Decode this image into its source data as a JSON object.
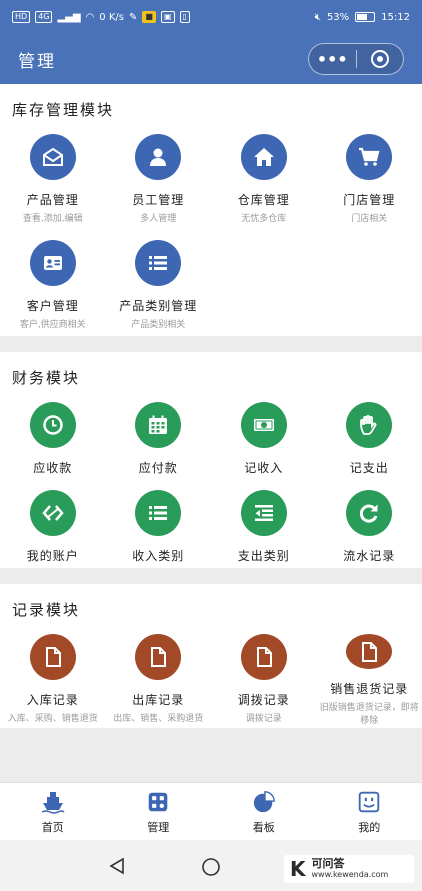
{
  "status_bar": {
    "left_chips": [
      "HD",
      "4G"
    ],
    "speed": "0 K/s",
    "battery_percent": "53%",
    "time": "15:12"
  },
  "nav": {
    "title": "管理",
    "more_label": "•••"
  },
  "sections": [
    {
      "title": "库存管理模块",
      "color": "#3d66b3",
      "items": [
        {
          "icon": "envelope-icon",
          "label": "产品管理",
          "desc": "查看,添加,编辑"
        },
        {
          "icon": "person-icon",
          "label": "员工管理",
          "desc": "多人管理"
        },
        {
          "icon": "home-icon",
          "label": "仓库管理",
          "desc": "无忧多仓库"
        },
        {
          "icon": "cart-icon",
          "label": "门店管理",
          "desc": "门店相关"
        },
        {
          "icon": "contact-card-icon",
          "label": "客户管理",
          "desc": "客户,供应商相关"
        },
        {
          "icon": "list-icon",
          "label": "产品类别管理",
          "desc": "产品类别相关"
        }
      ]
    },
    {
      "title": "财务模块",
      "color": "#2a9c5a",
      "items": [
        {
          "icon": "clock-icon",
          "label": "应收款",
          "desc": ""
        },
        {
          "icon": "calendar-icon",
          "label": "应付款",
          "desc": ""
        },
        {
          "icon": "banknote-icon",
          "label": "记收入",
          "desc": ""
        },
        {
          "icon": "hand-icon",
          "label": "记支出",
          "desc": ""
        },
        {
          "icon": "transfer-icon",
          "label": "我的账户",
          "desc": ""
        },
        {
          "icon": "list-icon",
          "label": "收入类别",
          "desc": ""
        },
        {
          "icon": "outdent-list-icon",
          "label": "支出类别",
          "desc": ""
        },
        {
          "icon": "refresh-icon",
          "label": "流水记录",
          "desc": ""
        }
      ]
    },
    {
      "title": "记录模块",
      "color": "#a24a28",
      "items": [
        {
          "icon": "document-icon",
          "label": "入库记录",
          "desc": "入库、采购、销售退货"
        },
        {
          "icon": "document-icon",
          "label": "出库记录",
          "desc": "出库、销售、采购退货"
        },
        {
          "icon": "document-icon",
          "label": "调拨记录",
          "desc": "调拨记录"
        },
        {
          "icon": "document-icon",
          "label": "销售退货记录",
          "desc": "旧版销售退货记录，即将移除"
        }
      ]
    }
  ],
  "tabbar": [
    {
      "icon": "ship-icon",
      "label": "首页",
      "color": "#3d66b3"
    },
    {
      "icon": "apps-icon",
      "label": "管理",
      "color": "#3d66b3"
    },
    {
      "icon": "pie-chart-icon",
      "label": "看板",
      "color": "#3d66b3"
    },
    {
      "icon": "face-icon",
      "label": "我的",
      "color": "#3d66b3"
    }
  ],
  "watermark": {
    "letter": "K",
    "name": "可问答",
    "url": "www.kewenda.com"
  }
}
